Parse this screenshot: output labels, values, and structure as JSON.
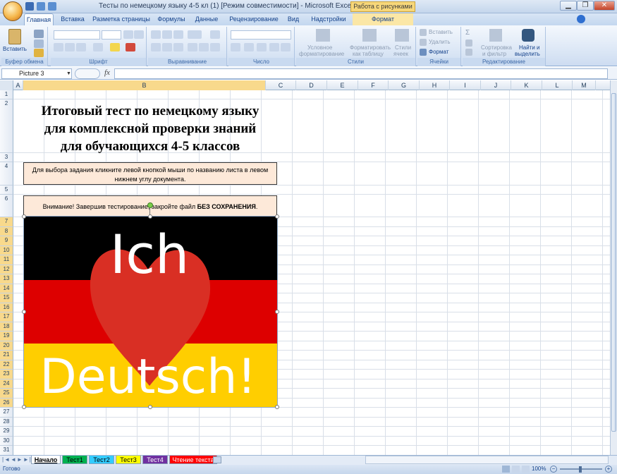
{
  "title_bar": {
    "title": "Тесты по немецкому языку 4-5 кл (1)  [Режим совместимости] - Microsoft Excel",
    "context_tab_title": "Работа с рисунками"
  },
  "tabs": [
    "Главная",
    "Вставка",
    "Разметка страницы",
    "Формулы",
    "Данные",
    "Рецензирование",
    "Вид",
    "Надстройки",
    "Формат"
  ],
  "ribbon": {
    "clipboard": {
      "paste": "Вставить",
      "label": "Буфер обмена"
    },
    "font": {
      "label": "Шрифт"
    },
    "alignment": {
      "label": "Выравнивание"
    },
    "number": {
      "label": "Число"
    },
    "styles": {
      "cond_format": [
        "Условное",
        "форматирование"
      ],
      "format_table": [
        "Форматировать",
        "как таблицу"
      ],
      "cell_styles": [
        "Стили",
        "ячеек"
      ],
      "label": "Стили"
    },
    "cells": {
      "insert": "Вставить",
      "delete": "Удалить",
      "format": "Формат",
      "label": "Ячейки"
    },
    "editing": {
      "sort_filter": [
        "Сортировка",
        "и фильтр"
      ],
      "find_select": [
        "Найти и",
        "выделить"
      ],
      "label": "Редактирование"
    }
  },
  "formula_bar": {
    "name_box": "Picture 3",
    "fx": "fx"
  },
  "columns": [
    "A",
    "B",
    "C",
    "D",
    "E",
    "F",
    "G",
    "H",
    "I",
    "J",
    "K",
    "L",
    "M"
  ],
  "rows": [
    "1",
    "2",
    "3",
    "4",
    "5",
    "6",
    "7",
    "8",
    "9",
    "10",
    "11",
    "12",
    "13",
    "14",
    "15",
    "16",
    "17",
    "18",
    "19",
    "20",
    "21",
    "22",
    "23",
    "24",
    "25",
    "26",
    "27",
    "28",
    "29",
    "30",
    "31"
  ],
  "content": {
    "heading": [
      "Итоговый тест по немецкому языку",
      "для комплексной проверки знаний",
      "для обучающихся 4-5 классов"
    ],
    "instruction": "Для выбора задания кликните левой кнопкой мыши по названию листа в левом нижнем углу документа.",
    "warning_text": "Внимание! Завершив тестирование, закройте файл ",
    "warning_bold": "БЕЗ СОХРАНЕНИЯ",
    "warning_end": ".",
    "picture_top": "Ich",
    "picture_bottom": "Deutsch!"
  },
  "colors": {
    "flag_black": "#000000",
    "flag_red": "#dd0000",
    "flag_gold": "#ffce00",
    "heart": "#d92f24",
    "note_fill": "#fde9d9"
  },
  "sheet_tabs": [
    {
      "label": "Начало",
      "color": "#ffffff"
    },
    {
      "label": "Тест1",
      "color": "#00b050"
    },
    {
      "label": "Тест2",
      "color": "#33ccff"
    },
    {
      "label": "Тест3",
      "color": "#ffff00"
    },
    {
      "label": "Тест4",
      "color": "#7030a0"
    },
    {
      "label": "Чтение текста",
      "color": "#ff0000"
    }
  ],
  "status": {
    "ready": "Готово",
    "zoom": "100%"
  }
}
